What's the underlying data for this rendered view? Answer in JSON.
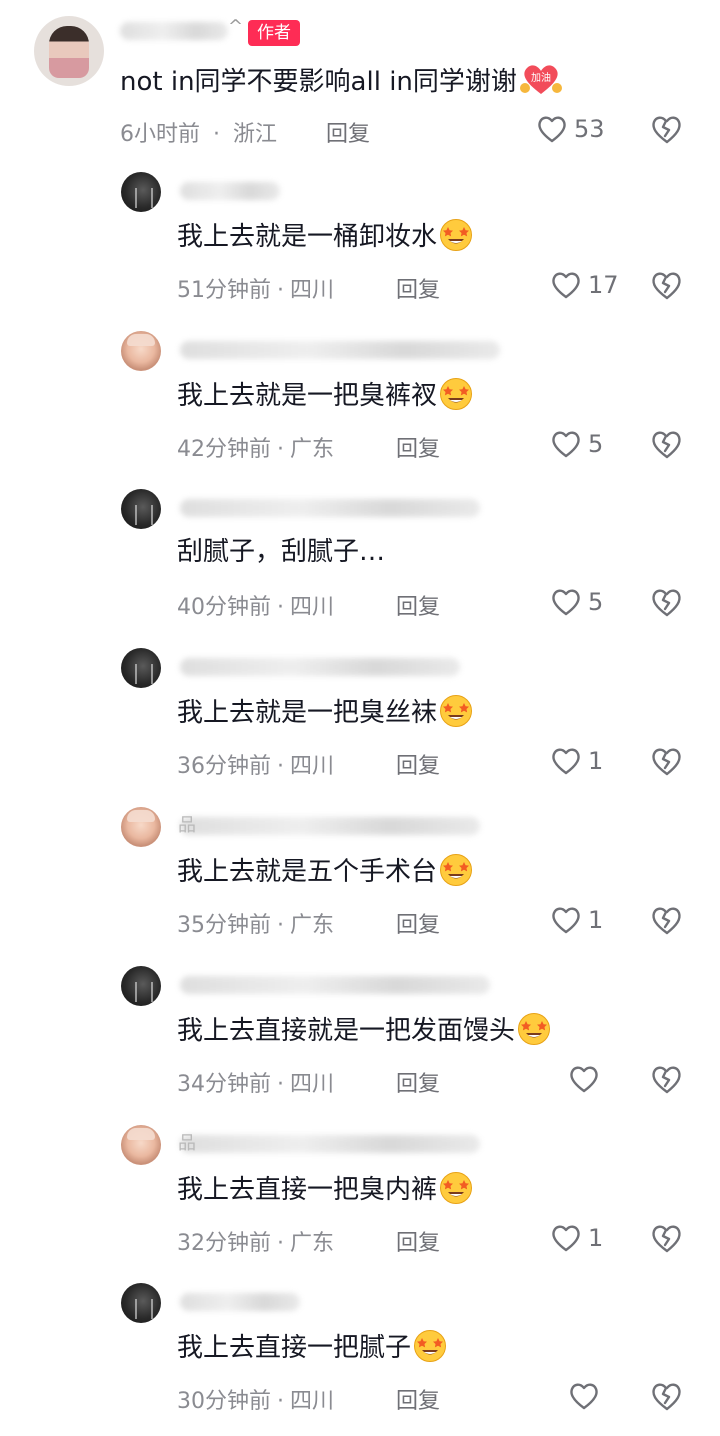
{
  "author_comment": {
    "name_visible": "^",
    "badge": "作者",
    "text": "not in同学不要影响all in同学谢谢",
    "time": "6小时前",
    "location": "浙江",
    "reply": "回复",
    "likes": "53",
    "sticker_text": "加油"
  },
  "separator": "·",
  "replies": [
    {
      "text": "我上去就是一桶卸妆水",
      "emoji": "star-struck-emoji",
      "time": "51分钟前",
      "location": "四川",
      "reply": "回复",
      "likes": "17",
      "name_frag": ""
    },
    {
      "text": "我上去就是一把臭裤衩",
      "emoji": "star-struck-emoji",
      "time": "42分钟前",
      "location": "广东",
      "reply": "回复",
      "likes": "5",
      "name_frag": ""
    },
    {
      "text": "刮腻子，刮腻子…",
      "emoji": "",
      "time": "40分钟前",
      "location": "四川",
      "reply": "回复",
      "likes": "5",
      "name_frag": ""
    },
    {
      "text": "我上去就是一把臭丝袜",
      "emoji": "star-struck-emoji",
      "time": "36分钟前",
      "location": "四川",
      "reply": "回复",
      "likes": "1",
      "name_frag": ""
    },
    {
      "text": "我上去就是五个手术台",
      "emoji": "star-struck-emoji",
      "time": "35分钟前",
      "location": "广东",
      "reply": "回复",
      "likes": "1",
      "name_frag": "品"
    },
    {
      "text": "我上去直接就是一把发面馒头",
      "emoji": "star-struck-emoji",
      "time": "34分钟前",
      "location": "四川",
      "reply": "回复",
      "likes": "",
      "name_frag": ""
    },
    {
      "text": "我上去直接一把臭内裤",
      "emoji": "star-struck-emoji",
      "time": "32分钟前",
      "location": "广东",
      "reply": "回复",
      "likes": "1",
      "name_frag": "品"
    },
    {
      "text": "我上去直接一把腻子",
      "emoji": "star-struck-emoji",
      "time": "30分钟前",
      "location": "四川",
      "reply": "回复",
      "likes": "",
      "name_frag": ""
    }
  ],
  "colors": {
    "badge": "#fe2c55",
    "text": "#161823",
    "meta": "#8a8b91"
  }
}
